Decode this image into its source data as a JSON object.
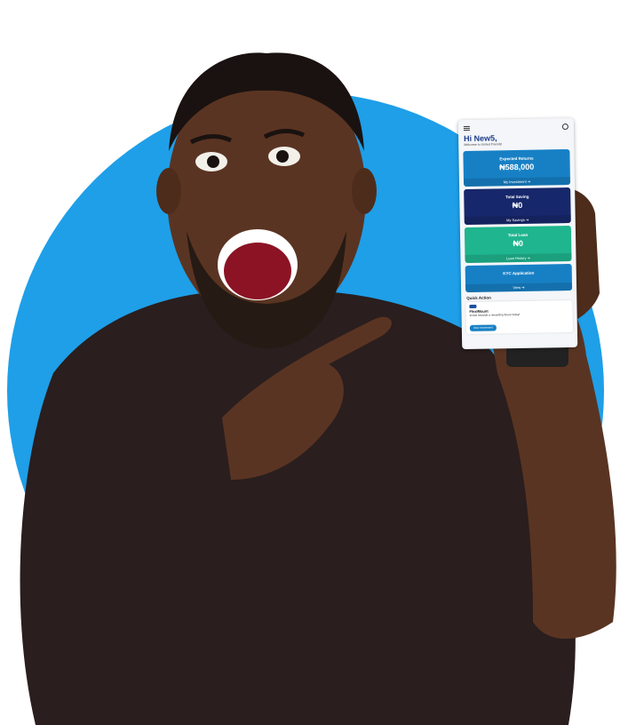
{
  "phone": {
    "greeting": "Hi New5,",
    "welcome": "Welcome to United Friends!",
    "cards": [
      {
        "title": "Expected Returns",
        "value": "₦588,000",
        "footer": "My Investment ➔"
      },
      {
        "title": "Total Saving",
        "value": "₦0",
        "footer": "My Savings ➔"
      },
      {
        "title": "Total Loan",
        "value": "₦0",
        "footer": "Loan History ➔"
      },
      {
        "title": "KYC Application",
        "footer": "View ➔"
      }
    ],
    "quick_action": {
      "label": "Quick Action",
      "title": "FlexiMount",
      "description": "Invest towards a rewarding future today!",
      "button": "View Investment"
    }
  },
  "colors": {
    "circle": "#1e9fe8",
    "card_blue": "#1780c5",
    "card_navy": "#17276b",
    "card_green": "#1fb58e",
    "shirt": "#2a1e1e",
    "skin": "#5a3422"
  }
}
